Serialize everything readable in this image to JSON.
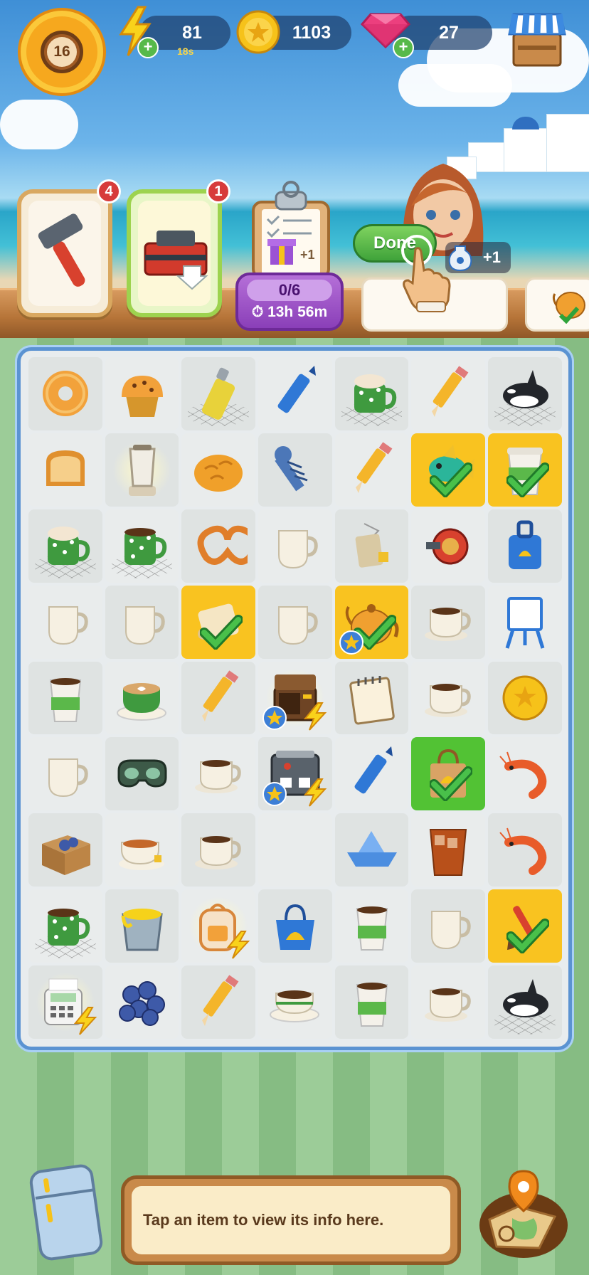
{
  "hud": {
    "level": "16",
    "energy": "81",
    "energy_timer": "18s",
    "coins": "1103",
    "gems": "27"
  },
  "producers": [
    {
      "name": "hammer",
      "badge": "4"
    },
    {
      "name": "toolbox",
      "badge": "1"
    }
  ],
  "tasks": {
    "progress": "0/6",
    "timer": "13h 56m",
    "reward": "+1"
  },
  "order": {
    "done_label": "Done",
    "reward_label": "+1"
  },
  "board": {
    "rows": [
      [
        {
          "item": "donut",
          "bg": "normal"
        },
        {
          "item": "muffin",
          "bg": "normal"
        },
        {
          "item": "spray-can",
          "bg": "normal",
          "web": true
        },
        {
          "item": "crayon-blue",
          "bg": "normal"
        },
        {
          "item": "hot-chocolate-mug",
          "bg": "normal",
          "web": true
        },
        {
          "item": "pencil",
          "bg": "normal"
        },
        {
          "item": "orca",
          "bg": "normal",
          "web": true
        }
      ],
      [
        {
          "item": "toast",
          "bg": "normal"
        },
        {
          "item": "blender",
          "bg": "normal",
          "glow": true
        },
        {
          "item": "bread-bun",
          "bg": "normal"
        },
        {
          "item": "screw",
          "bg": "normal"
        },
        {
          "item": "pencil",
          "bg": "normal"
        },
        {
          "item": "tropical-fish",
          "bg": "yellow",
          "check": true
        },
        {
          "item": "paper-cup",
          "bg": "yellow",
          "check": true
        }
      ],
      [
        {
          "item": "hot-chocolate-mug",
          "bg": "normal",
          "web": true
        },
        {
          "item": "green-dot-mug",
          "bg": "normal",
          "web": true
        },
        {
          "item": "pretzel",
          "bg": "normal"
        },
        {
          "item": "white-cup",
          "bg": "normal"
        },
        {
          "item": "tea-bag",
          "bg": "normal"
        },
        {
          "item": "fishing-reel",
          "bg": "normal"
        },
        {
          "item": "rolling-suitcase",
          "bg": "normal"
        }
      ],
      [
        {
          "item": "white-cup",
          "bg": "normal"
        },
        {
          "item": "white-cup",
          "bg": "normal"
        },
        {
          "item": "scroll",
          "bg": "yellow",
          "check": true
        },
        {
          "item": "white-cup",
          "bg": "normal"
        },
        {
          "item": "teapot",
          "bg": "yellow",
          "check": true,
          "star": true
        },
        {
          "item": "coffee-cup",
          "bg": "normal"
        },
        {
          "item": "easel",
          "bg": "normal"
        }
      ],
      [
        {
          "item": "coffee-to-go",
          "bg": "normal"
        },
        {
          "item": "latte-cup",
          "bg": "normal"
        },
        {
          "item": "pencil",
          "bg": "normal"
        },
        {
          "item": "toaster-oven",
          "bg": "normal",
          "glow": true,
          "star": true,
          "bolt": true
        },
        {
          "item": "notepad",
          "bg": "normal"
        },
        {
          "item": "coffee-cup",
          "bg": "normal"
        },
        {
          "item": "gold-coin",
          "bg": "normal"
        }
      ],
      [
        {
          "item": "white-cup",
          "bg": "normal"
        },
        {
          "item": "goggles",
          "bg": "normal"
        },
        {
          "item": "coffee-cup",
          "bg": "normal"
        },
        {
          "item": "espresso-machine",
          "bg": "normal",
          "star": true,
          "bolt": true
        },
        {
          "item": "crayon-blue",
          "bg": "normal"
        },
        {
          "item": "shopping-bag",
          "bg": "green",
          "check": true
        },
        {
          "item": "shrimp",
          "bg": "normal"
        }
      ],
      [
        {
          "item": "cardboard-box",
          "bg": "normal"
        },
        {
          "item": "tea-cup",
          "bg": "normal"
        },
        {
          "item": "coffee-cup",
          "bg": "normal"
        },
        {
          "item": "empty",
          "bg": "empty"
        },
        {
          "item": "paper-boat",
          "bg": "normal"
        },
        {
          "item": "iced-tea-glass",
          "bg": "normal"
        },
        {
          "item": "shrimp",
          "bg": "normal"
        }
      ],
      [
        {
          "item": "green-dot-mug",
          "bg": "normal",
          "web": true
        },
        {
          "item": "paint-bucket",
          "bg": "normal"
        },
        {
          "item": "backpack",
          "bg": "normal",
          "glow": true,
          "bolt": true
        },
        {
          "item": "beach-tote",
          "bg": "normal"
        },
        {
          "item": "coffee-to-go",
          "bg": "normal"
        },
        {
          "item": "white-cup",
          "bg": "normal"
        },
        {
          "item": "paintbrush",
          "bg": "yellow",
          "check": true
        }
      ],
      [
        {
          "item": "card-reader",
          "bg": "normal",
          "glow": true,
          "bolt": true
        },
        {
          "item": "buttons-pile",
          "bg": "normal"
        },
        {
          "item": "pencil",
          "bg": "normal"
        },
        {
          "item": "espresso-cup",
          "bg": "normal"
        },
        {
          "item": "coffee-to-go",
          "bg": "normal"
        },
        {
          "item": "coffee-cup",
          "bg": "normal"
        },
        {
          "item": "orca",
          "bg": "normal",
          "web": true
        }
      ]
    ]
  },
  "info": {
    "text": "Tap an item to view its info here."
  },
  "colors": {
    "accent_yellow": "#f9c320",
    "accent_green": "#52c234",
    "board_border": "#5b93d2"
  }
}
